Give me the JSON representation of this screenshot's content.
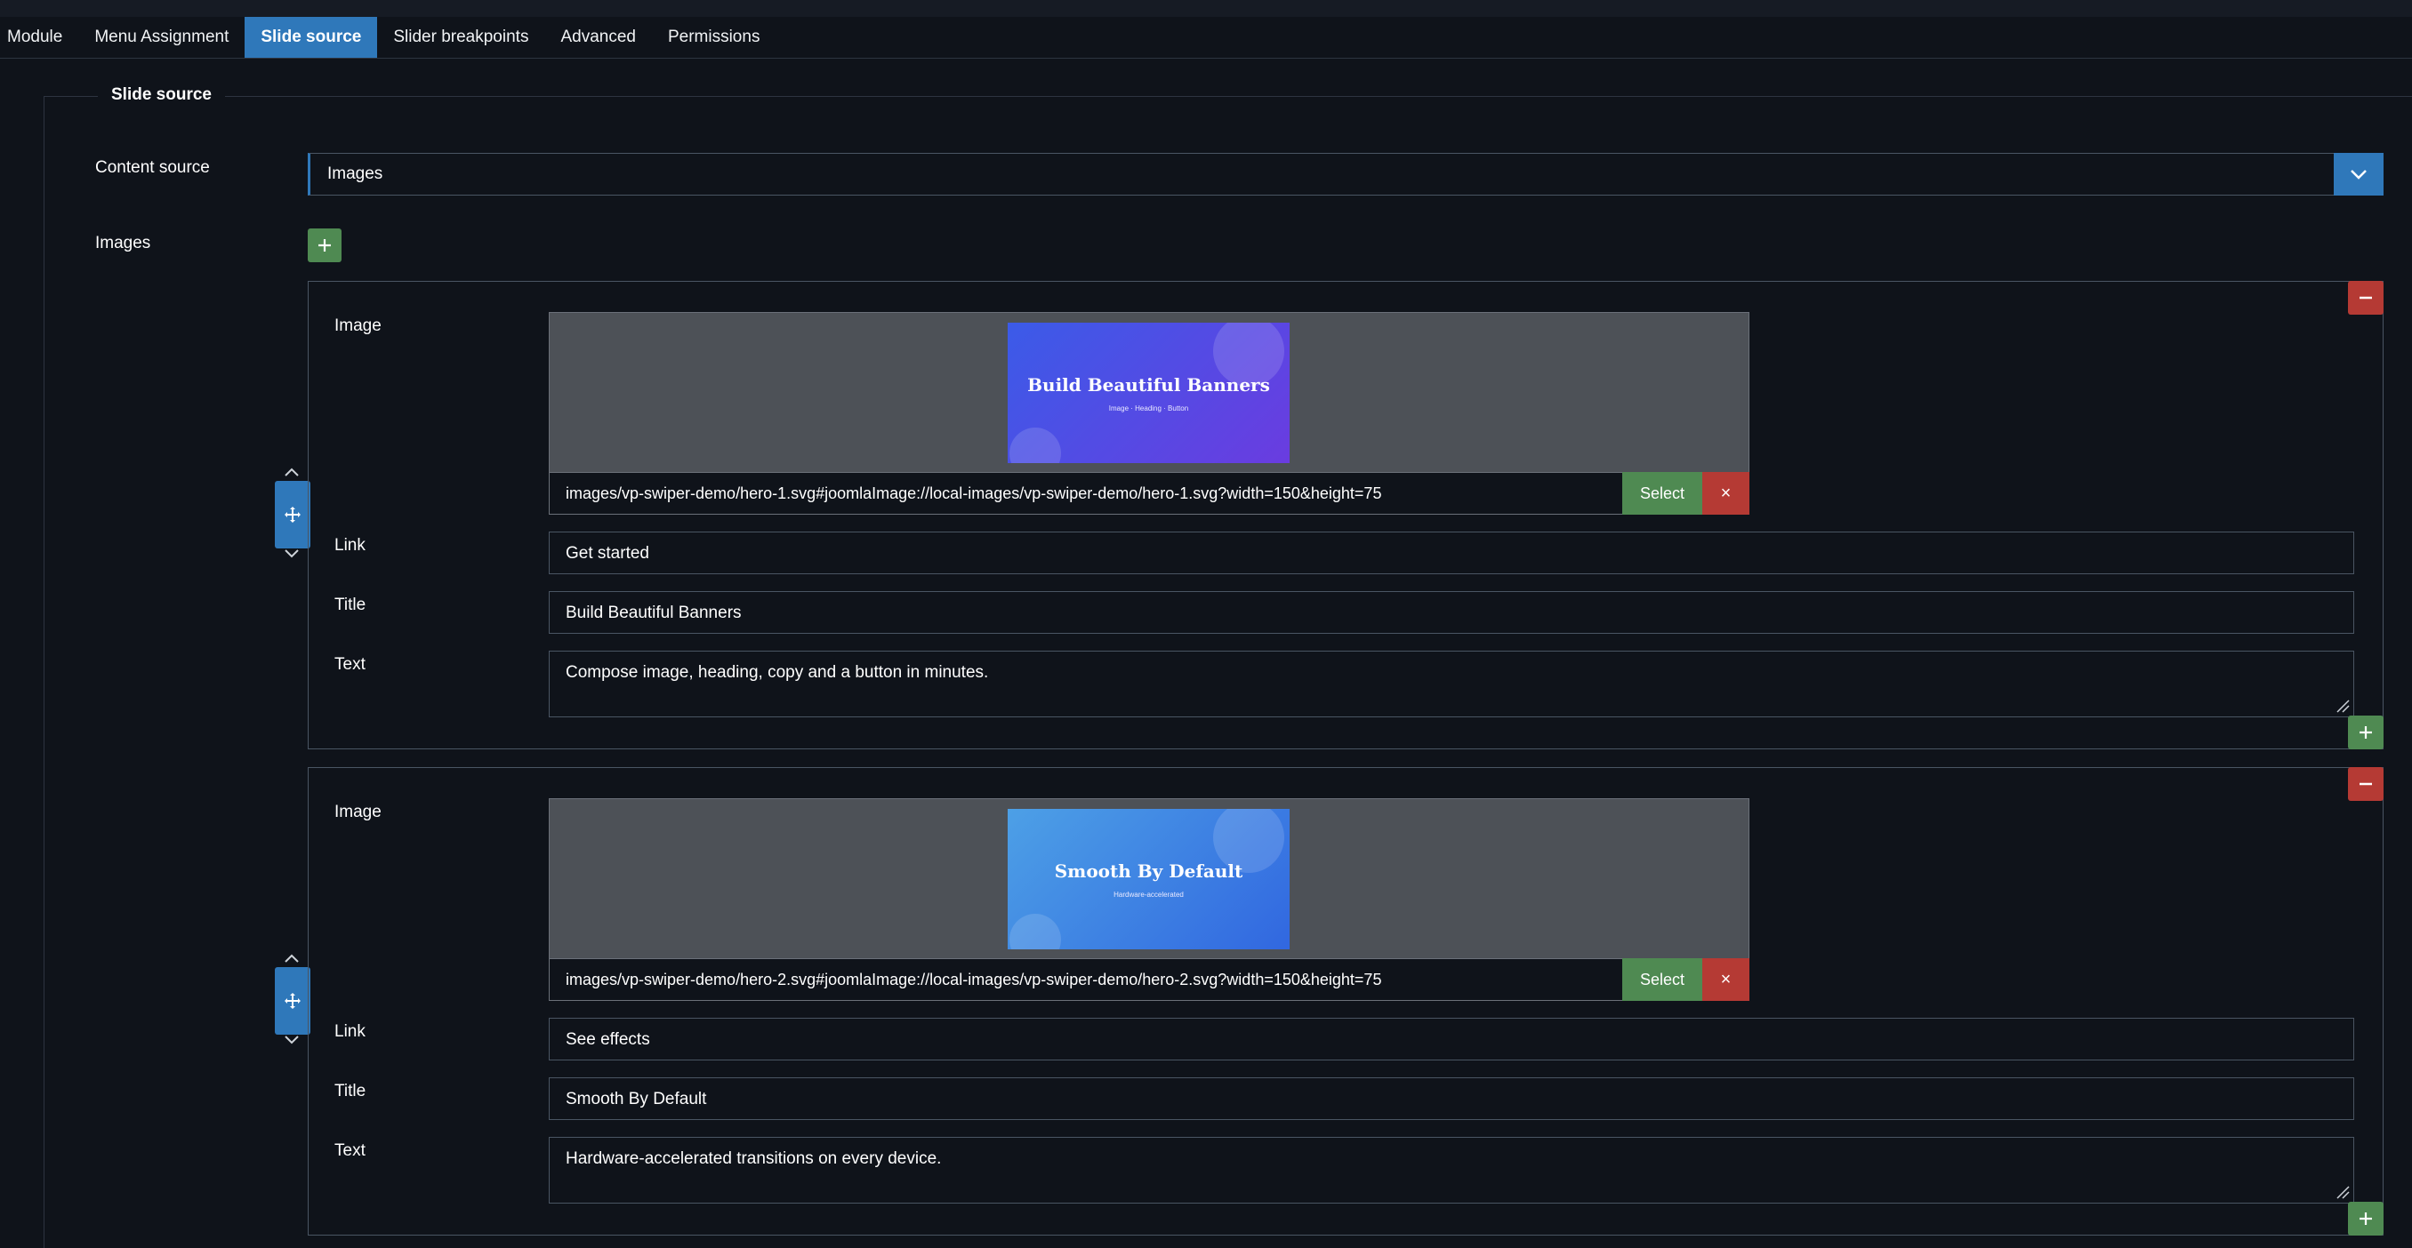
{
  "tabs": [
    {
      "label": "Module",
      "active": false
    },
    {
      "label": "Menu Assignment",
      "active": false
    },
    {
      "label": "Slide source",
      "active": true
    },
    {
      "label": "Slider breakpoints",
      "active": false
    },
    {
      "label": "Advanced",
      "active": false
    },
    {
      "label": "Permissions",
      "active": false
    }
  ],
  "fieldset": {
    "legend": "Slide source"
  },
  "content_source": {
    "label": "Content source",
    "value": "Images"
  },
  "images": {
    "label": "Images",
    "field_labels": {
      "image": "Image",
      "link": "Link",
      "title": "Title",
      "text": "Text"
    },
    "select_label": "Select",
    "clear_symbol": "×",
    "items": [
      {
        "path": "images/vp-swiper-demo/hero-1.svg#joomlaImage://local-images/vp-swiper-demo/hero-1.svg?width=150&height=75",
        "thumb_title": "Build Beautiful Banners",
        "thumb_sub": "Image · Heading · Button",
        "link": "Get started",
        "title": "Build Beautiful Banners",
        "text": "Compose image, heading, copy and a button in minutes."
      },
      {
        "path": "images/vp-swiper-demo/hero-2.svg#joomlaImage://local-images/vp-swiper-demo/hero-2.svg?width=150&height=75",
        "thumb_title": "Smooth By Default",
        "thumb_sub": "Hardware-accelerated",
        "link": "See effects",
        "title": "Smooth By Default",
        "text": "Hardware-accelerated transitions on every device."
      }
    ]
  },
  "colors": {
    "accent": "#2f78ba",
    "success": "#4f8a52",
    "danger": "#b53a34",
    "background": "#0f131a"
  }
}
